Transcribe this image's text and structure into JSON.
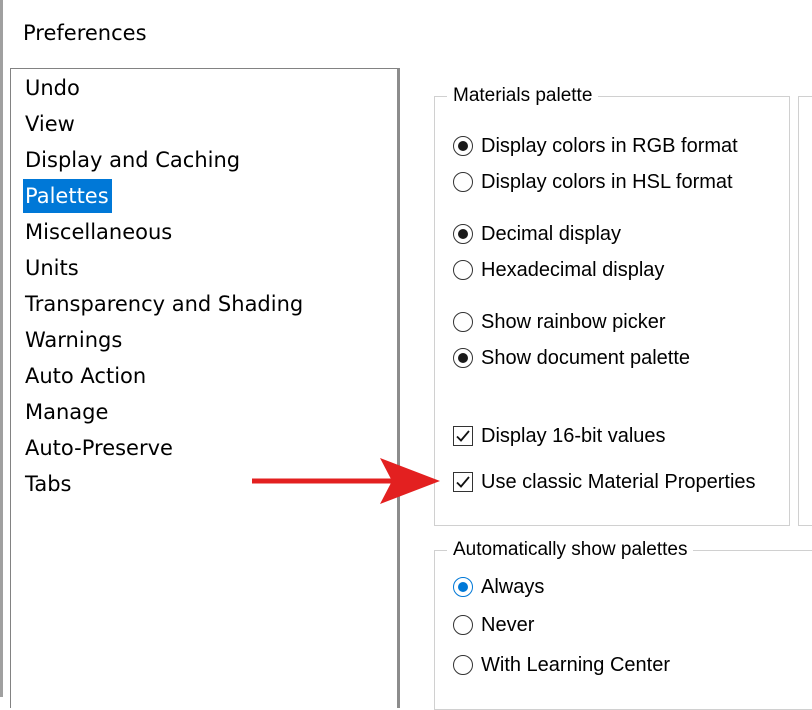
{
  "window": {
    "title": "Preferences"
  },
  "categories": [
    "Undo",
    "View",
    "Display and Caching",
    "Palettes",
    "Miscellaneous",
    "Units",
    "Transparency and Shading",
    "Warnings",
    "Auto Action",
    "Manage",
    "Auto-Preserve",
    "Tabs"
  ],
  "selected_category": "Palettes",
  "materials_palette": {
    "legend": "Materials palette",
    "color_format": {
      "rgb": "Display colors in RGB format",
      "hsl": "Display colors in HSL format",
      "selected": "rgb"
    },
    "number_display": {
      "decimal": "Decimal display",
      "hex": "Hexadecimal display",
      "selected": "decimal"
    },
    "picker": {
      "rainbow": "Show rainbow picker",
      "document": "Show document palette",
      "selected": "document"
    },
    "display_16bit": {
      "label": "Display 16-bit values",
      "checked": true
    },
    "classic_material": {
      "label": "Use classic Material Properties",
      "checked": true
    }
  },
  "auto_show": {
    "legend": "Automatically show palettes",
    "always": "Always",
    "never": "Never",
    "learning": "With Learning Center",
    "selected": "always"
  },
  "colors": {
    "selection": "#0078d7",
    "arrow": "#e32020",
    "accent": "#0078d7"
  }
}
